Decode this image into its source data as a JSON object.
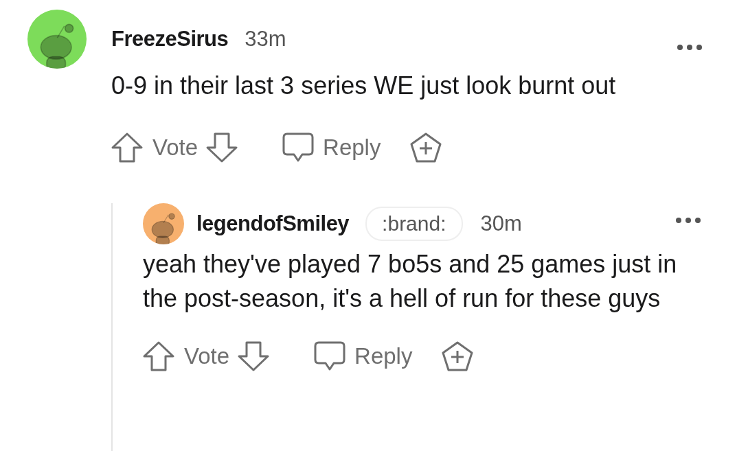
{
  "comments": [
    {
      "author": "FreezeSirus",
      "time": "33m",
      "color": "#7ddc5a",
      "body": "0-9 in their last 3 series WE just look burnt out",
      "actions": {
        "vote": "Vote",
        "reply": "Reply"
      },
      "children": [
        {
          "author": "legendofSmiley",
          "flair": ":brand:",
          "time": "30m",
          "color": "#f7b06e",
          "body": "yeah they've played 7 bo5s and 25 games just in the post-season, it's a hell of run for these guys",
          "actions": {
            "vote": "Vote",
            "reply": "Reply"
          }
        }
      ]
    }
  ]
}
